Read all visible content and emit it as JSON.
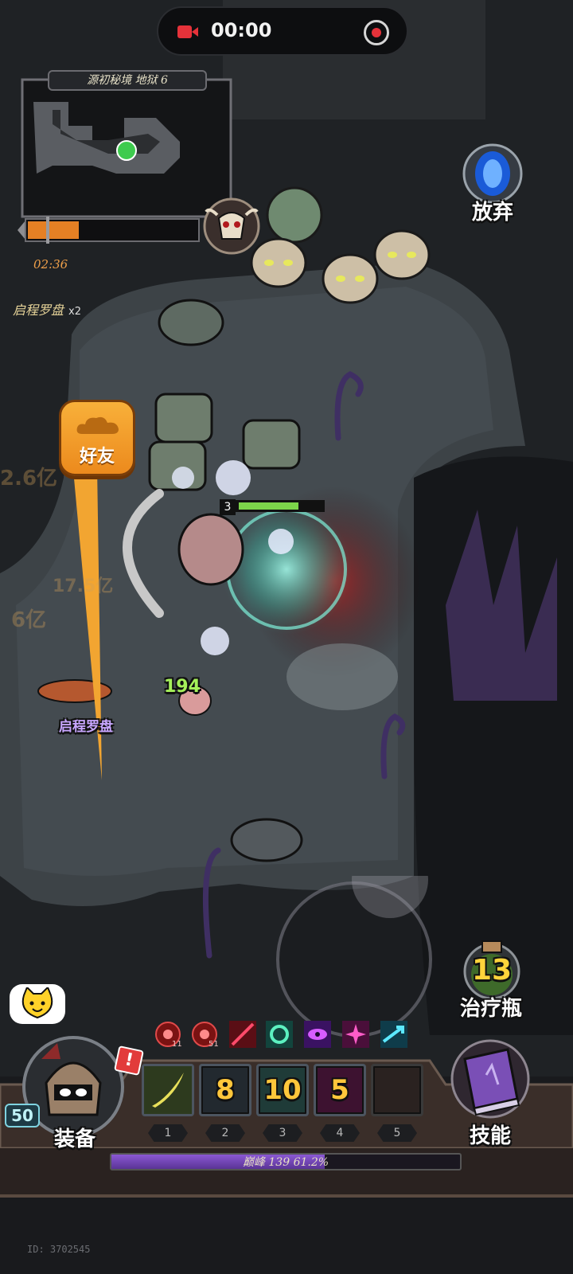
{
  "recorder": {
    "time": "00:00"
  },
  "map": {
    "title": "源初秘境 地狱 6",
    "time_left": "02:36",
    "progress": 0.3
  },
  "buffs_top": {
    "name": "启程罗盘",
    "count": "x2"
  },
  "buttons": {
    "abandon": "放弃",
    "friend": "好友",
    "potion": "治疗瓶",
    "equip": "装备",
    "skills": "技能"
  },
  "potion_count": "13",
  "player": {
    "level_tag": "3",
    "hp_fraction": 0.72,
    "portrait_level": "50",
    "alert": "!"
  },
  "field": {
    "npc_name": "启程罗盘",
    "damage": "194",
    "ghost_numbers": [
      "2.6亿",
      "17.5亿",
      "6亿"
    ]
  },
  "buff_bar": [
    {
      "icon": "red-orb-icon",
      "stack": "11"
    },
    {
      "icon": "red-orb-icon",
      "stack": "51"
    },
    {
      "icon": "red-slash-icon",
      "stack": ""
    },
    {
      "icon": "green-swirl-icon",
      "stack": ""
    },
    {
      "icon": "purple-eye-icon",
      "stack": ""
    },
    {
      "icon": "pink-burst-icon",
      "stack": ""
    },
    {
      "icon": "cyan-arrow-icon",
      "stack": ""
    }
  ],
  "skill_slots": [
    {
      "index": "1",
      "cooldown": ""
    },
    {
      "index": "2",
      "cooldown": "8"
    },
    {
      "index": "3",
      "cooldown": "10"
    },
    {
      "index": "4",
      "cooldown": "5"
    },
    {
      "index": "5",
      "cooldown": ""
    }
  ],
  "xp": {
    "label": "巅峰 139",
    "percent_text": "61.2%",
    "fraction": 0.612
  },
  "footer": {
    "player_id": "ID: 3702545"
  },
  "colors": {
    "accent_orange": "#f2a531",
    "xp_purple": "#7b4cc6",
    "cooldown_yellow": "#ffc73b"
  }
}
